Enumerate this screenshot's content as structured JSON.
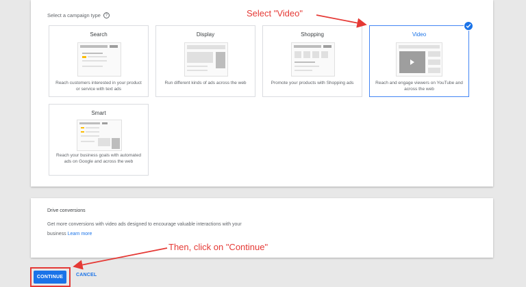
{
  "campaign_type": {
    "label": "Select a campaign type",
    "tiles": [
      {
        "title": "Search",
        "description": "Reach customers interested in your product or service with text ads",
        "selected": false
      },
      {
        "title": "Display",
        "description": "Run different kinds of ads across the web",
        "selected": false
      },
      {
        "title": "Shopping",
        "description": "Promote your products with Shopping ads",
        "selected": false
      },
      {
        "title": "Video",
        "description": "Reach and engage viewers on YouTube and across the web",
        "selected": true
      },
      {
        "title": "Smart",
        "description": "Reach your business goals with automated ads on Google and across the web",
        "selected": false
      }
    ]
  },
  "goal": {
    "title": "Drive conversions",
    "description": "Get more conversions with video ads designed to encourage valuable interactions with your business",
    "link": "Learn more"
  },
  "actions": {
    "continue_label": "CONTINUE",
    "cancel_label": "CANCEL"
  },
  "annotations": {
    "select_video": "Select \"Video\"",
    "click_continue": "Then, click on \"Continue\""
  },
  "colors": {
    "accent": "#1a73e8",
    "annotation": "#e53935",
    "yellow": "#fbbc04"
  }
}
